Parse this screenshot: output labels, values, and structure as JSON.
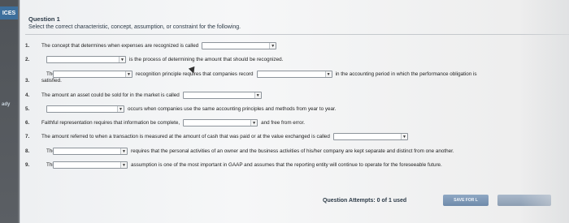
{
  "sidebar": {
    "tab_label": "ICES",
    "side_label": "ady"
  },
  "question": {
    "title": "Question 1",
    "instruction": "Select the correct characteristic, concept, assumption, or constraint for the following."
  },
  "items": [
    {
      "num": "1.",
      "pre": "The concept that determines when expenses are recognized is called",
      "post": ""
    },
    {
      "num": "2.",
      "pre": "",
      "post": "is the process of determining the amount that should be recognized."
    },
    {
      "num": "3.",
      "pre": "The",
      "mid": "recognition principle requires that companies record",
      "post": "in the accounting period in which the performance obligation is",
      "cont": "satisfied."
    },
    {
      "num": "4.",
      "pre": "The amount an asset could be sold for in the market is called",
      "post": ""
    },
    {
      "num": "5.",
      "pre": "",
      "post": "occurs when companies use the same accounting principles and methods from year to year."
    },
    {
      "num": "6.",
      "pre": "Faithful representation requires that information be complete,",
      "post": "and free from error."
    },
    {
      "num": "7.",
      "pre": "The amount referred to when a transaction is measured at the amount of cash that was paid or at the value exchanged is called",
      "post": ""
    },
    {
      "num": "8.",
      "pre": "The",
      "post": "requires that the personal activities of an owner and the business activities of his/her company are kept separate and distinct from one another."
    },
    {
      "num": "9.",
      "pre": "This",
      "post": "assumption is one of the most important in GAAP and assumes that the reporting entity will continue to operate for the foreseeable future."
    }
  ],
  "footer": {
    "attempts": "Question Attempts: 0 of 1 used",
    "save_label": "SAVE FOR L"
  },
  "icons": {
    "dropdown": "chevron-down-icon"
  }
}
